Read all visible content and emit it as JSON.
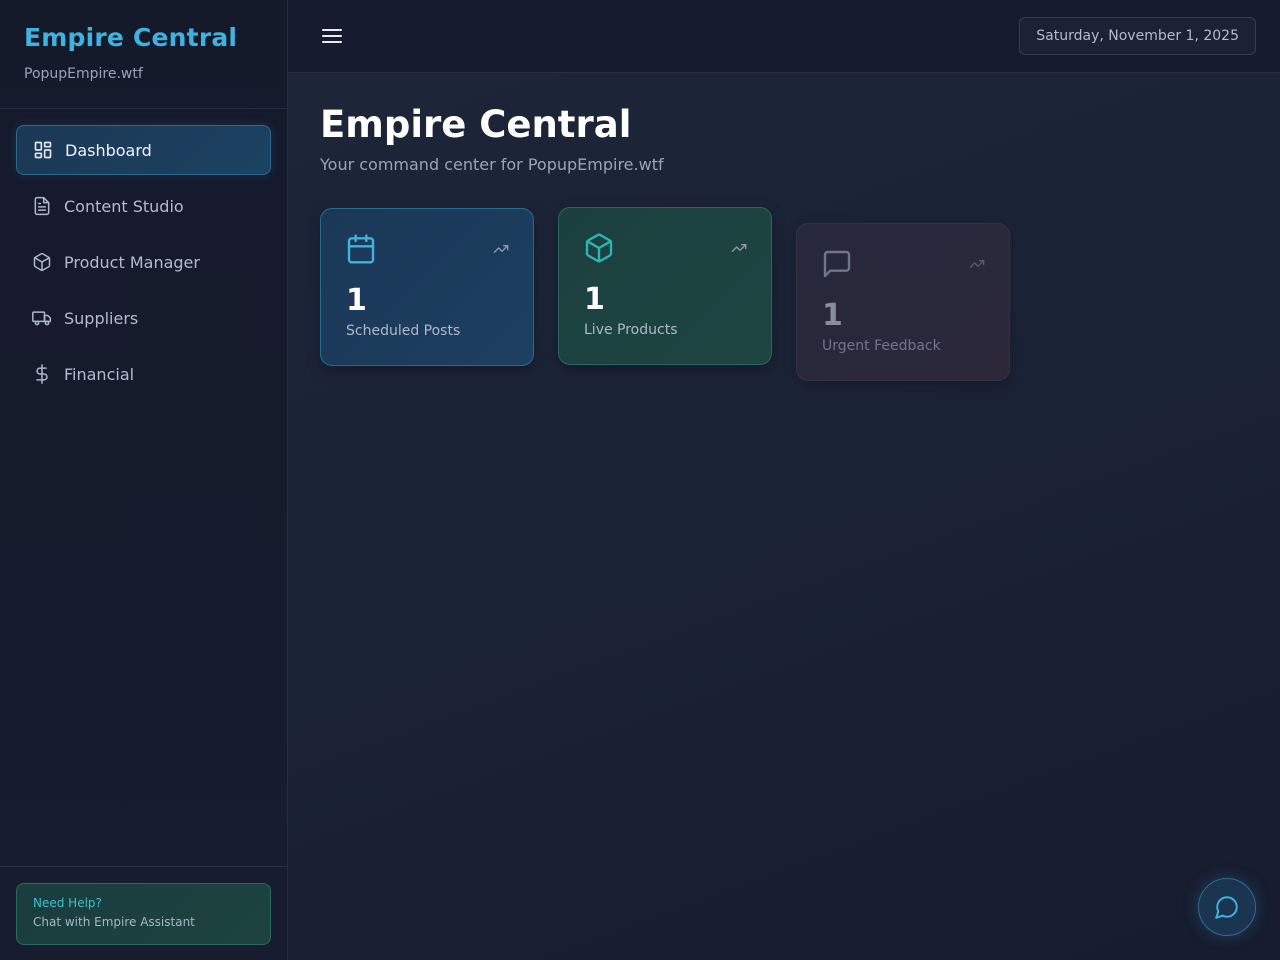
{
  "sidebar": {
    "brand_title": "Empire Central",
    "brand_subtitle": "PopupEmpire.wtf",
    "items": [
      {
        "label": "Dashboard",
        "icon": "dashboard-icon",
        "active": true
      },
      {
        "label": "Content Studio",
        "icon": "document-icon",
        "active": false
      },
      {
        "label": "Product Manager",
        "icon": "package-icon",
        "active": false
      },
      {
        "label": "Suppliers",
        "icon": "truck-icon",
        "active": false
      },
      {
        "label": "Financial",
        "icon": "dollar-icon",
        "active": false
      }
    ],
    "help": {
      "title": "Need Help?",
      "subtitle": "Chat with Empire Assistant"
    }
  },
  "topbar": {
    "date": "Saturday, November 1, 2025"
  },
  "main": {
    "title": "Empire Central",
    "subtitle": "Your command center for PopupEmpire.wtf",
    "cards": [
      {
        "value": "1",
        "label": "Scheduled Posts",
        "icon": "calendar-icon",
        "accent": "#3fb3e0"
      },
      {
        "value": "1",
        "label": "Live Products",
        "icon": "package-icon",
        "accent": "#2fb3b0"
      },
      {
        "value": "1",
        "label": "Urgent Feedback",
        "icon": "message-icon",
        "accent": "#7d8598"
      }
    ]
  },
  "colors": {
    "accent": "#3fb3e0",
    "background": "#161c2e"
  }
}
